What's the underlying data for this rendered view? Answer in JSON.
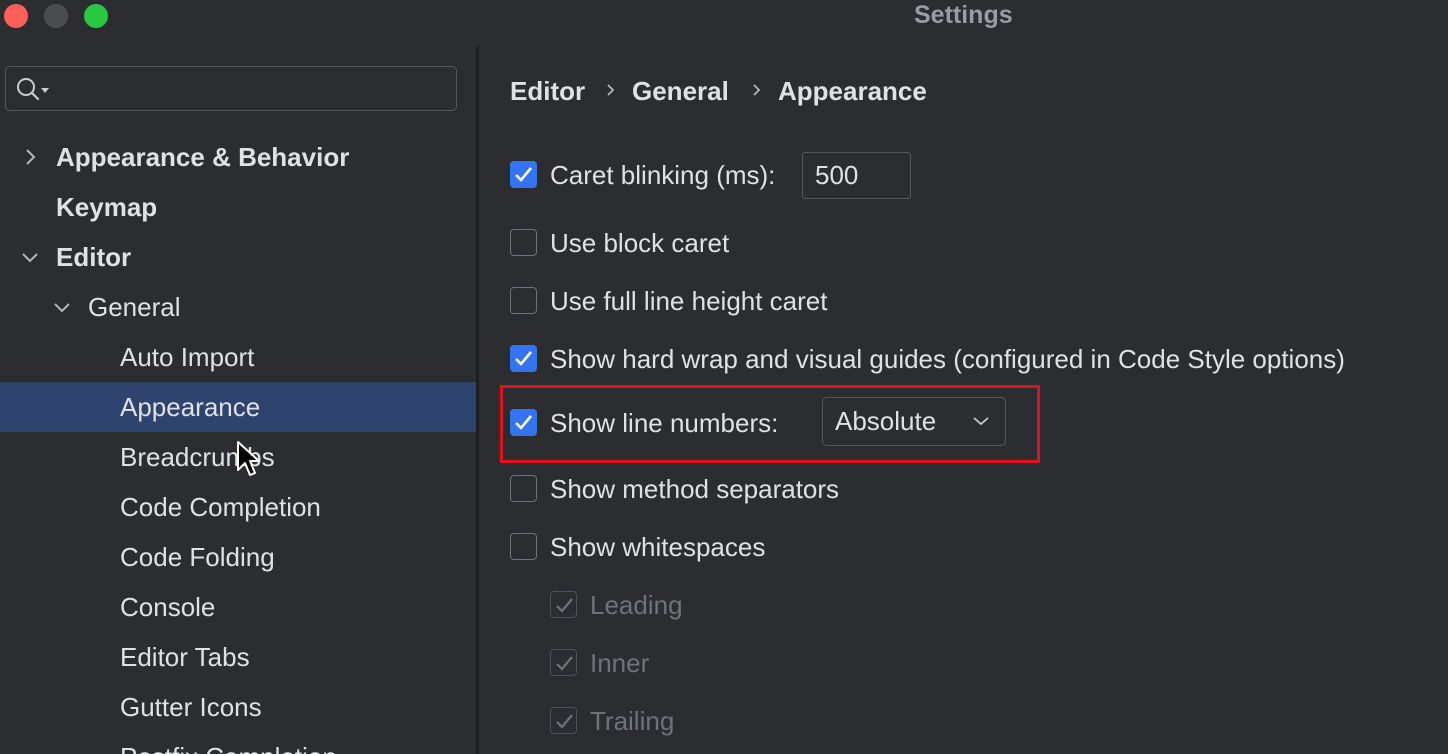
{
  "window": {
    "title": "Settings"
  },
  "search": {
    "value": "",
    "placeholder": ""
  },
  "sidebar": {
    "items": [
      {
        "label": "Appearance & Behavior",
        "level": 0,
        "expanded": false,
        "has_children": true,
        "bold": true
      },
      {
        "label": "Keymap",
        "level": 0,
        "has_children": false,
        "bold": true
      },
      {
        "label": "Editor",
        "level": 0,
        "expanded": true,
        "has_children": true,
        "bold": true
      },
      {
        "label": "General",
        "level": 1,
        "expanded": true,
        "has_children": true
      },
      {
        "label": "Auto Import",
        "level": 2
      },
      {
        "label": "Appearance",
        "level": 2,
        "selected": true
      },
      {
        "label": "Breadcrumbs",
        "level": 2
      },
      {
        "label": "Code Completion",
        "level": 2
      },
      {
        "label": "Code Folding",
        "level": 2
      },
      {
        "label": "Console",
        "level": 2
      },
      {
        "label": "Editor Tabs",
        "level": 2
      },
      {
        "label": "Gutter Icons",
        "level": 2
      },
      {
        "label": "Postfix Completion",
        "level": 2
      }
    ]
  },
  "breadcrumb": [
    "Editor",
    "General",
    "Appearance"
  ],
  "options": {
    "caret_blinking": {
      "label": "Caret blinking (ms):",
      "checked": true,
      "value": "500"
    },
    "block_caret": {
      "label": "Use block caret",
      "checked": false
    },
    "full_line_caret": {
      "label": "Use full line height caret",
      "checked": false
    },
    "hard_wrap": {
      "label": "Show hard wrap and visual guides (configured in Code Style options)",
      "checked": true
    },
    "line_numbers": {
      "label": "Show line numbers:",
      "checked": true,
      "selected": "Absolute"
    },
    "method_separators": {
      "label": "Show method separators",
      "checked": false
    },
    "whitespaces": {
      "label": "Show whitespaces",
      "checked": false
    },
    "leading": {
      "label": "Leading",
      "checked": true,
      "disabled": true
    },
    "inner": {
      "label": "Inner",
      "checked": true,
      "disabled": true
    },
    "trailing": {
      "label": "Trailing",
      "checked": true,
      "disabled": true
    }
  },
  "colors": {
    "accent": "#3574f0",
    "selection": "#2e436e",
    "highlight": "#e0101c",
    "background": "#2b2d30"
  }
}
